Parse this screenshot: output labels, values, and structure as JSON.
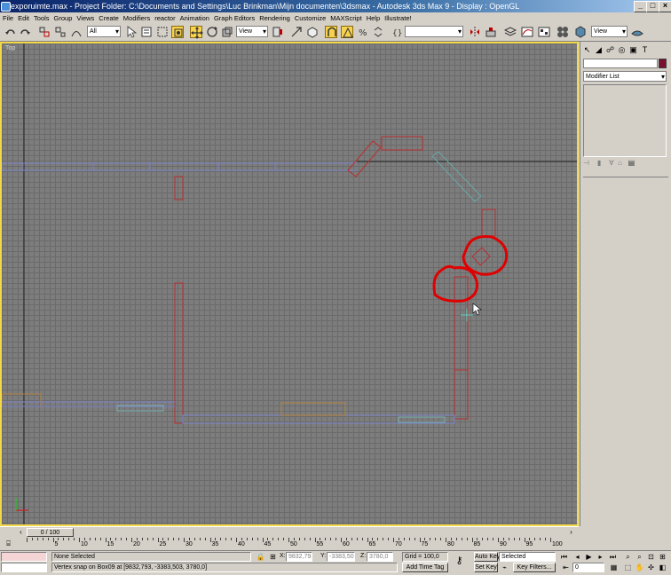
{
  "window": {
    "title": "exporuimte.max    - Project Folder: C:\\Documents and Settings\\Luc Brinkman\\Mijn documenten\\3dsmax     - Autodesk 3ds Max 9      - Display : OpenGL"
  },
  "menu": [
    "File",
    "Edit",
    "Tools",
    "Group",
    "Views",
    "Create",
    "Modifiers",
    "reactor",
    "Animation",
    "Graph Editors",
    "Rendering",
    "Customize",
    "MAXScript",
    "Help",
    "Illustrate!"
  ],
  "toolbar": {
    "selection_filter": "All",
    "ref_coord": "View",
    "named_sel": "",
    "view_dropdown": "View"
  },
  "viewport": {
    "label": "Top"
  },
  "command_panel": {
    "modifier_list": "Modifier List"
  },
  "time_slider": {
    "position": "0 / 100"
  },
  "trackbar": {
    "ticks": [
      "0",
      "5",
      "10",
      "15",
      "20",
      "25",
      "30",
      "35",
      "40",
      "45",
      "50",
      "55",
      "60",
      "65",
      "70",
      "75",
      "80",
      "85",
      "90",
      "95",
      "100"
    ]
  },
  "status": {
    "selection": "None Selected",
    "prompt": "Vertex snap on Box09 at [9832,793, -3383,503, 3780,0]",
    "x_label": "X:",
    "x": "9832,793",
    "y_label": "Y:",
    "y": "-3383,503",
    "z_label": "Z:",
    "z": "3780,0",
    "grid": "Grid = 100,0",
    "add_time_tag": "Add Time Tag",
    "auto_key": "Auto Key",
    "key_mode": "Selected",
    "set_key": "Set Key",
    "key_filters": "Key Filters...",
    "frame": "0"
  }
}
